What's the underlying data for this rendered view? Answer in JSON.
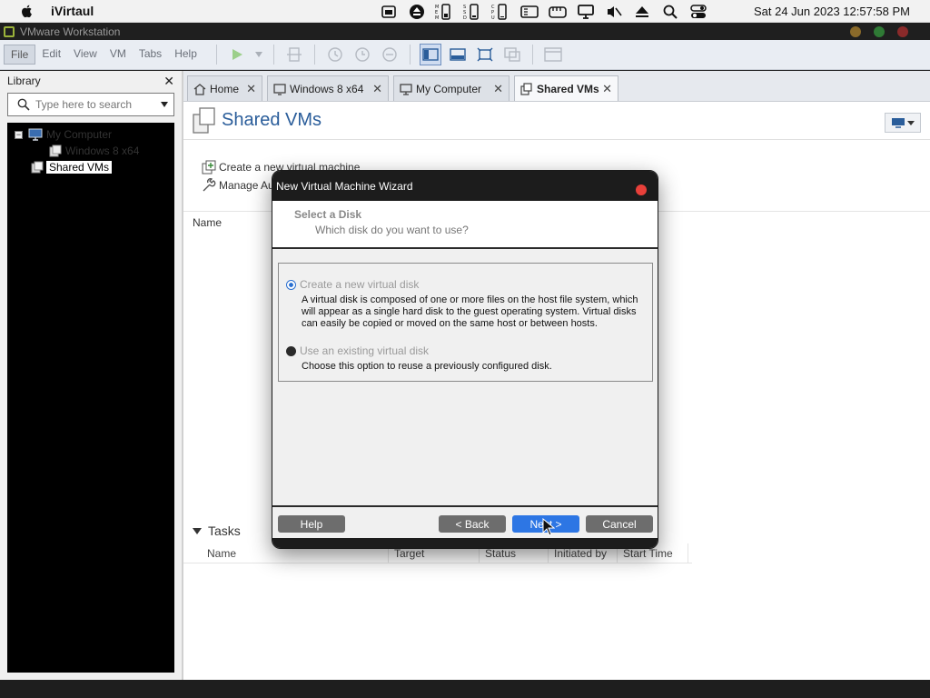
{
  "mac_menubar": {
    "app_name": "iVirtaul",
    "status_icons": [
      "calendar-icon",
      "eject-icon",
      "memory-icon",
      "ssd-icon",
      "cpu-icon",
      "panel-icon",
      "cloud-icon",
      "monitor-icon",
      "mute-icon",
      "eject-up-icon",
      "search-icon",
      "control-center-icon"
    ],
    "clock": "Sat 24 Jun 2023  12:57:58 PM"
  },
  "window": {
    "title": "VMware Workstation"
  },
  "menu": {
    "items": [
      "File",
      "Edit",
      "View",
      "VM",
      "Tabs",
      "Help"
    ]
  },
  "library": {
    "title": "Library",
    "search_placeholder": "Type here to search",
    "tree": [
      {
        "label": "My Computer",
        "icon": "computer-icon"
      },
      {
        "label": "Windows 8 x64",
        "icon": "vm-icon"
      },
      {
        "label": "Shared VMs",
        "icon": "shared-vms-icon"
      }
    ]
  },
  "tabs": [
    {
      "label": "Home",
      "icon": "home-icon"
    },
    {
      "label": "Windows 8 x64",
      "icon": "vm-icon"
    },
    {
      "label": "My Computer",
      "icon": "computer-icon"
    },
    {
      "label": "Shared VMs",
      "icon": "shared-vms-icon"
    }
  ],
  "page": {
    "title": "Shared VMs",
    "actions": [
      "Create a new virtual machine",
      "Manage Au"
    ],
    "col_name": "Name"
  },
  "tasks": {
    "title": "Tasks",
    "columns": [
      "Name",
      "Target",
      "Status",
      "Initiated by",
      "Start Time"
    ]
  },
  "wizard": {
    "title": "New Virtual Machine Wizard",
    "step": "Select a Disk",
    "question": "Which disk do you want to use?",
    "option1_label": "Create a new virtual disk",
    "option1_desc": "A virtual disk is composed of one or more files on the host file system, which will appear as a single hard disk to the guest operating system. Virtual disks can easily be copied or moved on the same host or between hosts.",
    "option2_label": "Use an existing virtual disk",
    "option2_desc": "Choose this option to reuse a previously configured disk.",
    "buttons": {
      "help": "Help",
      "back": "< Back",
      "next": "Next >",
      "cancel": "Cancel"
    }
  },
  "colors": {
    "accent": "#2d76e4",
    "title_blue": "#2a5d9a",
    "close_red": "#e8403a"
  }
}
